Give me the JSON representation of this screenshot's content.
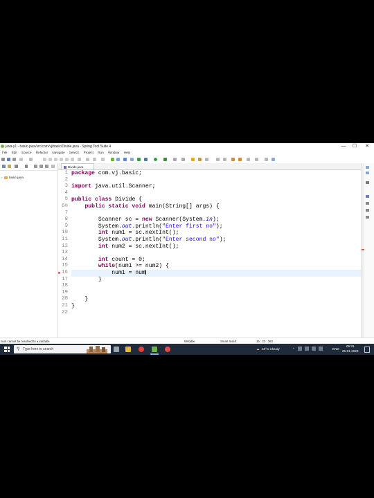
{
  "window": {
    "title": "java-y1 - basic-java/src/com/vj/basic/Divide.java - Spring Tool Suite 4",
    "minimize": "—",
    "maximize": "☐",
    "close": "✕"
  },
  "menu": [
    "File",
    "Edit",
    "Source",
    "Refactor",
    "Navigate",
    "Search",
    "Project",
    "Run",
    "Window",
    "Help"
  ],
  "package_explorer": {
    "tree_item": "basic-java"
  },
  "editor": {
    "tab_label": "Divide.java",
    "line_numbers": [
      "1",
      "2",
      "3",
      "4",
      "5",
      "6⊖",
      "7",
      "8",
      "9",
      "10",
      "11",
      "12",
      "13",
      "14",
      "15",
      "16",
      "17",
      "18",
      "19",
      "20",
      "21",
      "22"
    ],
    "lines": [
      [
        {
          "t": "package",
          "c": "kw"
        },
        {
          "t": " com.vj.basic;"
        }
      ],
      [],
      [
        {
          "t": "import",
          "c": "kw"
        },
        {
          "t": " java.util.Scanner;"
        }
      ],
      [],
      [
        {
          "t": "public class",
          "c": "kw"
        },
        {
          "t": " Divide {"
        }
      ],
      [
        {
          "t": "    "
        },
        {
          "t": "public static void",
          "c": "kw"
        },
        {
          "t": " main(String[] args) {"
        }
      ],
      [],
      [
        {
          "t": "        Scanner sc = "
        },
        {
          "t": "new",
          "c": "kw"
        },
        {
          "t": " Scanner(System."
        },
        {
          "t": "in",
          "c": "fld"
        },
        {
          "t": ");"
        }
      ],
      [
        {
          "t": "        System."
        },
        {
          "t": "out",
          "c": "fld"
        },
        {
          "t": ".println("
        },
        {
          "t": "\"Enter first no\"",
          "c": "str"
        },
        {
          "t": ");"
        }
      ],
      [
        {
          "t": "        "
        },
        {
          "t": "int",
          "c": "kw"
        },
        {
          "t": " num1 = sc.nextInt();"
        }
      ],
      [
        {
          "t": "        System."
        },
        {
          "t": "out",
          "c": "fld"
        },
        {
          "t": ".println("
        },
        {
          "t": "\"Enter second no\"",
          "c": "str"
        },
        {
          "t": ");"
        }
      ],
      [
        {
          "t": "        "
        },
        {
          "t": "int",
          "c": "kw"
        },
        {
          "t": " num2 = sc.nextInt();"
        }
      ],
      [],
      [
        {
          "t": "        "
        },
        {
          "t": "int",
          "c": "kw"
        },
        {
          "t": " count = 0;"
        }
      ],
      [
        {
          "t": "        "
        },
        {
          "t": "while",
          "c": "kw"
        },
        {
          "t": "(num1 >= num2) {"
        }
      ],
      [
        {
          "t": "            num1 = num"
        }
      ],
      [
        {
          "t": "        }"
        }
      ],
      [],
      [],
      [
        {
          "t": "    }"
        }
      ],
      [
        {
          "t": "}"
        }
      ],
      []
    ],
    "current_line": 16,
    "error_line": 16
  },
  "status": {
    "message": "num cannot be resolved to a variable",
    "mode": "Writable",
    "insert": "Smart Insert",
    "position": "16 : 23 : 363"
  },
  "taskbar": {
    "search_placeholder": "Type here to search",
    "weather": "19°C  Cloudy",
    "lang": "ENG",
    "time": "09:31",
    "date": "25-01-2023"
  }
}
